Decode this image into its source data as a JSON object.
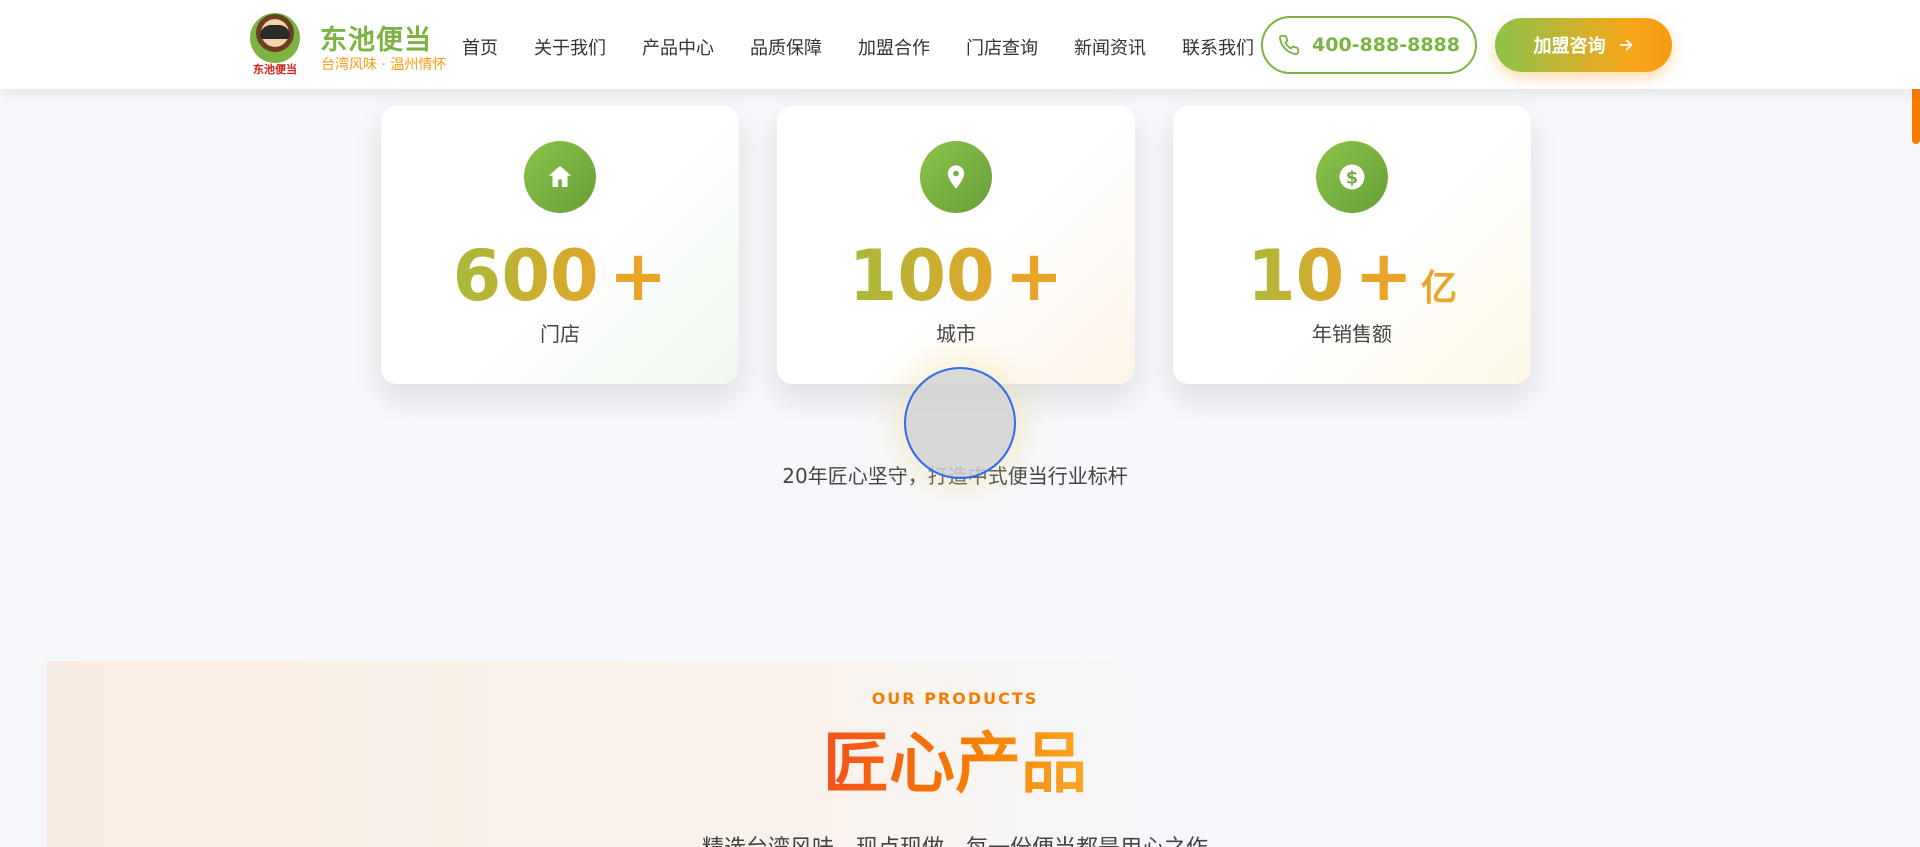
{
  "header": {
    "brand": {
      "name": "东池便当",
      "tagline": "台湾风味 · 温州情怀",
      "logo_text": "东池便当"
    },
    "nav": [
      {
        "label": "首页"
      },
      {
        "label": "关于我们"
      },
      {
        "label": "产品中心"
      },
      {
        "label": "品质保障"
      },
      {
        "label": "加盟合作"
      },
      {
        "label": "门店查询"
      },
      {
        "label": "新闻资讯"
      },
      {
        "label": "联系我们"
      }
    ],
    "phone": {
      "label": "400-888-8888",
      "icon": "phone-icon"
    },
    "cta": {
      "label": "加盟咨询",
      "icon": "arrow-right-icon"
    }
  },
  "stats": [
    {
      "icon": "home-icon",
      "value": "600",
      "suffix": "+",
      "unit": "",
      "label": "门店"
    },
    {
      "icon": "location-pin-icon",
      "value": "100",
      "suffix": "+",
      "unit": "",
      "label": "城市"
    },
    {
      "icon": "dollar-icon",
      "value": "10",
      "suffix": "+",
      "unit": "亿",
      "label": "年销售额"
    }
  ],
  "tagline": "20年匠心坚守，打造中式便当行业标杆",
  "products": {
    "eyebrow": "OUR PRODUCTS",
    "title": "匠心产品",
    "subtitle": "精选台湾风味，现点现做，每一份便当都是用心之作"
  },
  "colors": {
    "brand_green": "#7cb342",
    "brand_orange": "#f39c12",
    "accent_red_orange": "#f4511e",
    "scrollbar": "#f57c00"
  }
}
